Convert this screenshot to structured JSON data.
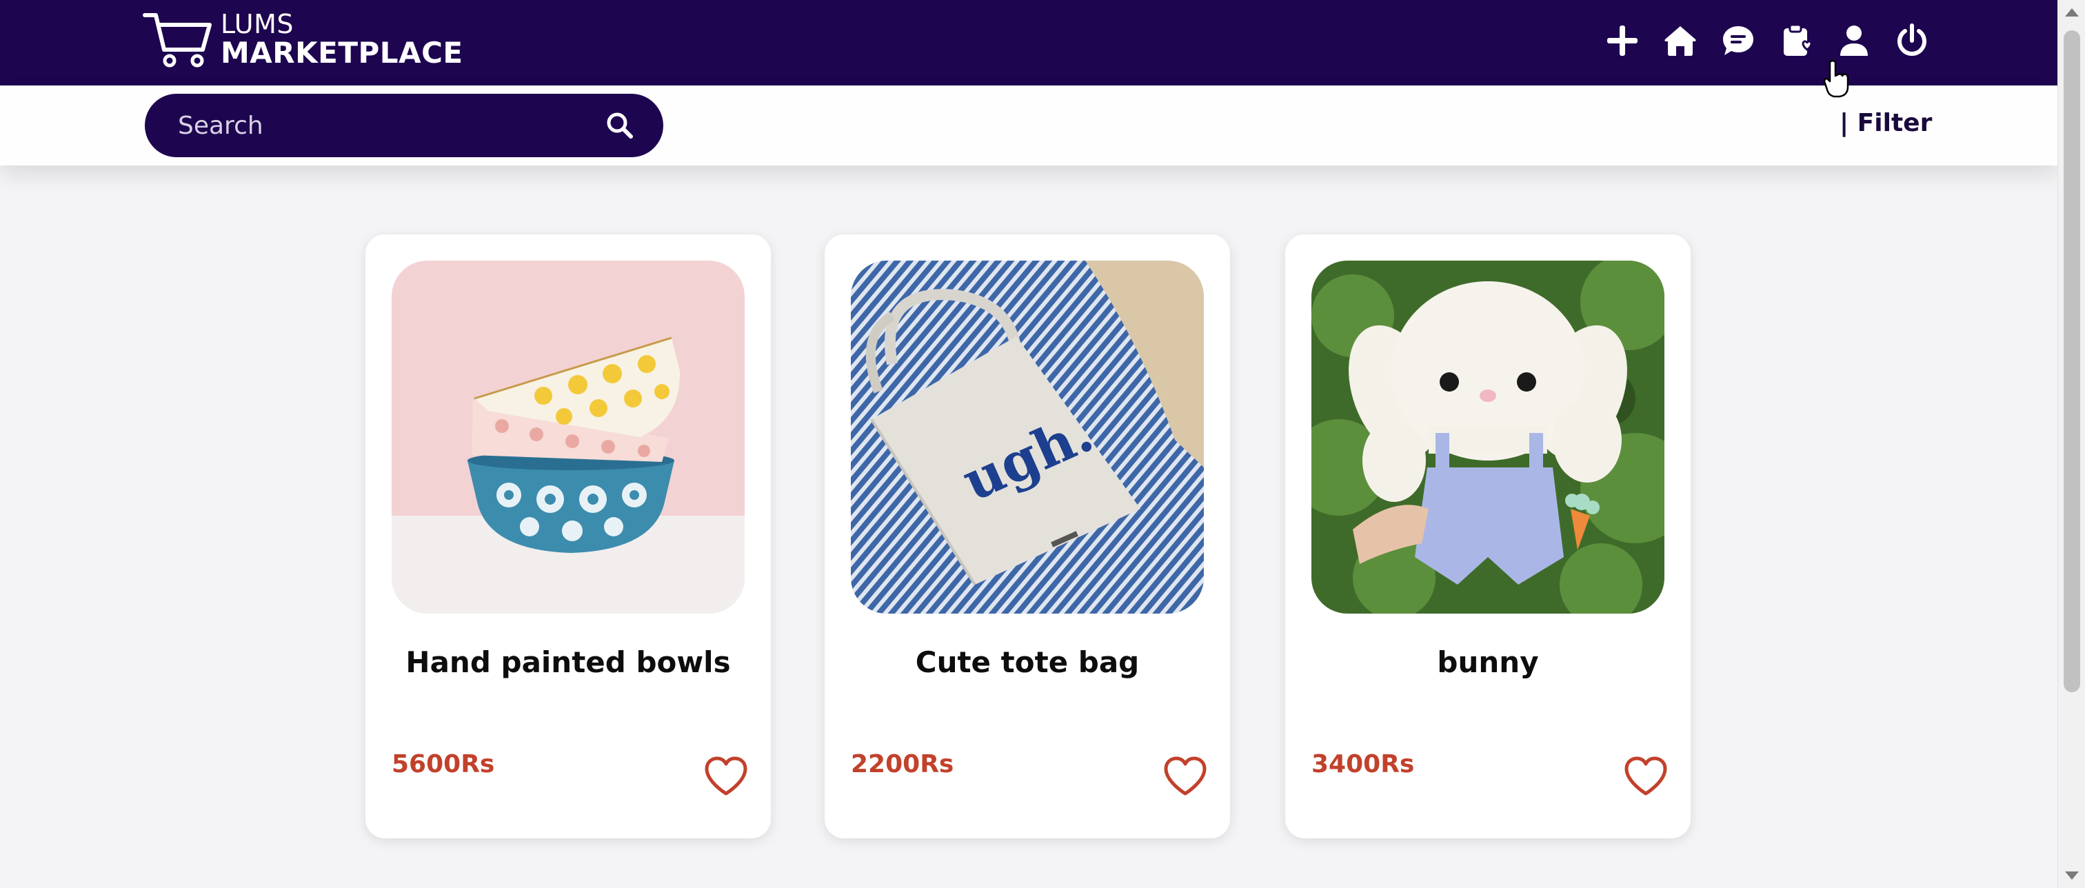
{
  "app": {
    "logo_top": "LUMS",
    "logo_bottom": "MARKETPLACE"
  },
  "nav": {
    "icons": [
      "plus-icon",
      "home-icon",
      "chat-icon",
      "clipboard-heart-icon",
      "user-icon",
      "power-icon"
    ]
  },
  "search": {
    "placeholder": "Search"
  },
  "filter": {
    "label": "| Filter"
  },
  "colors": {
    "brand": "#1e0550",
    "price": "#c2412b"
  },
  "products": [
    {
      "title": "Hand painted bowls",
      "price": "5600Rs"
    },
    {
      "title": "Cute tote bag",
      "price": "2200Rs"
    },
    {
      "title": "bunny",
      "price": "3400Rs"
    }
  ]
}
